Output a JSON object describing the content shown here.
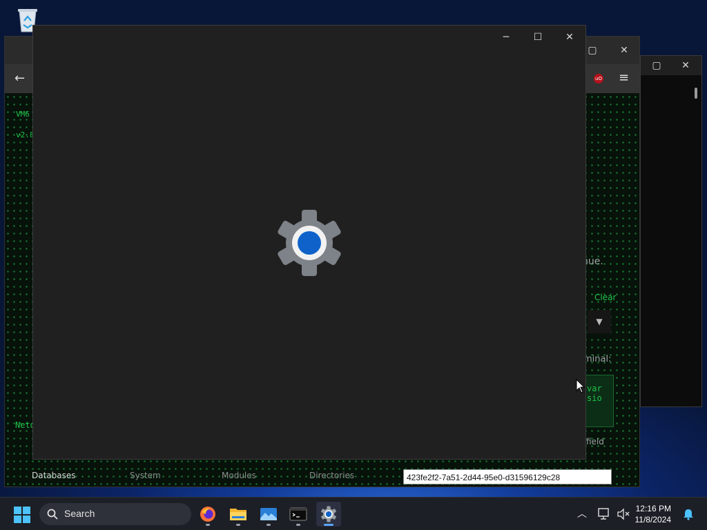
{
  "desktop": {
    "recycle_bin_icon": "recycle-bin-icon"
  },
  "console_window": {
    "maximize_icon": "maximize-icon",
    "close_icon": "close-icon"
  },
  "vm_app": {
    "header_line1": "VM6",
    "header_line2": "v2.8",
    "footer_left": "Netd",
    "right_text_1": "nue.",
    "clear_link": "Clear",
    "right_text_2": "minal:",
    "terminal_snippet_1": "var",
    "terminal_snippet_2": "sio",
    "right_text_3": "field",
    "uuid_value": "423fe2f2-7a51-2d44-95e0-d31596129c28",
    "nav": [
      {
        "label": "Databases"
      },
      {
        "label": "System"
      },
      {
        "label": "Modules"
      },
      {
        "label": "Directories"
      }
    ]
  },
  "settings_window": {
    "icon": "settings-gear-icon"
  },
  "taskbar": {
    "search_placeholder": "Search",
    "apps": [
      "firefox-icon",
      "file-explorer-icon",
      "photos-icon",
      "terminal-icon",
      "settings-icon"
    ],
    "time": "12:16 PM",
    "date": "11/8/2024"
  },
  "colors": {
    "accent": "#0067c0",
    "terminal_green": "#1fc44a",
    "window_bg": "#202020"
  }
}
